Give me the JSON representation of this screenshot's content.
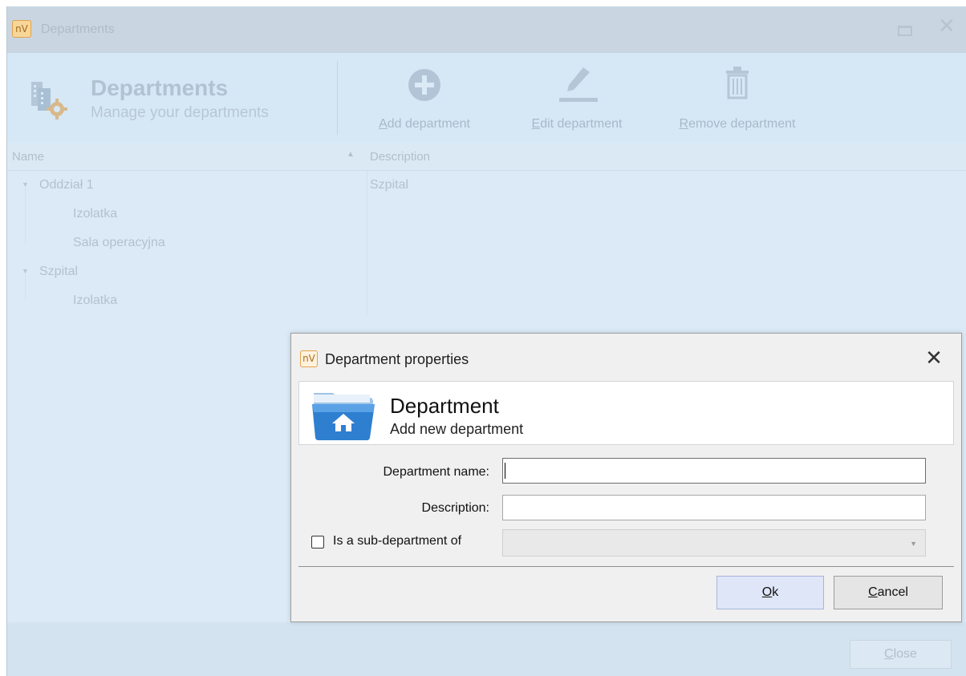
{
  "main_window": {
    "title": "Departments",
    "header": {
      "title": "Departments",
      "subtitle": "Manage your departments"
    },
    "toolbar": {
      "add_label": "Add department",
      "edit_label": "Edit department",
      "remove_label": "Remove department"
    },
    "grid": {
      "columns": [
        "Name",
        "Description"
      ],
      "rows": [
        {
          "name": "Oddział 1",
          "description": "Szpital",
          "level": 0,
          "expanded": true
        },
        {
          "name": "Izolatka",
          "description": "",
          "level": 1
        },
        {
          "name": "Sala operacyjna",
          "description": "",
          "level": 1
        },
        {
          "name": "Szpital",
          "description": "",
          "level": 0,
          "expanded": true
        },
        {
          "name": "Izolatka",
          "description": "",
          "level": 1
        }
      ]
    },
    "close_label": "Close"
  },
  "dialog": {
    "title": "Department properties",
    "banner": {
      "title": "Department",
      "subtitle": "Add new department"
    },
    "fields": {
      "name_label": "Department name:",
      "name_value": "",
      "description_label": "Description:",
      "description_value": "",
      "sub_department_label": "Is a sub-department of",
      "sub_department_checked": false
    },
    "ok_label": "Ok",
    "cancel_label": "Cancel"
  },
  "logo_text": "nV",
  "colors": {
    "ribbon_bg": "#d6e8f6",
    "dialog_bg": "#f0f0f0",
    "ok_button_bg": "#dfe6f7",
    "logo_orange": "#e2a24c"
  }
}
